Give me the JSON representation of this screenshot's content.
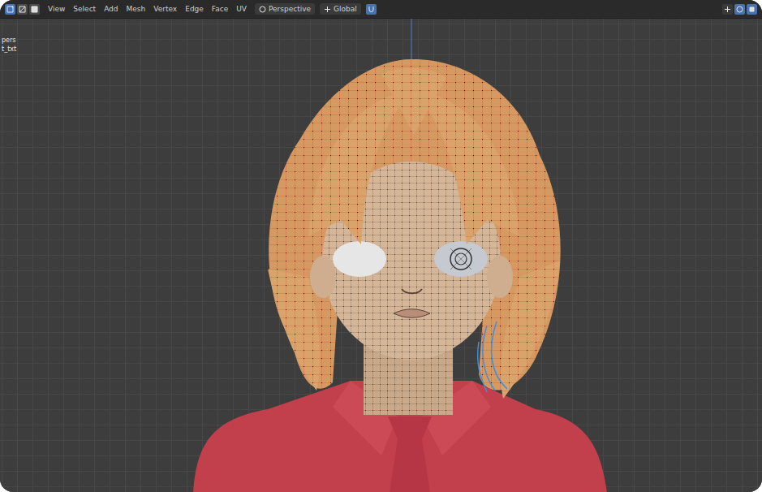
{
  "select_modes": [
    {
      "kind": "vertex",
      "selected": true
    },
    {
      "kind": "edge",
      "selected": false
    },
    {
      "kind": "face",
      "selected": false
    }
  ],
  "menus": [
    "View",
    "Select",
    "Add",
    "Mesh",
    "Vertex",
    "Edge",
    "Face",
    "UV"
  ],
  "pivot": "Perspective",
  "orientation": "Global",
  "snap": {
    "on": true
  },
  "right_tools": [
    {
      "kind": "gizmo",
      "on": false
    },
    {
      "kind": "overlay",
      "on": true
    },
    {
      "kind": "shading",
      "on": true
    }
  ],
  "overlay_lines": [
    "pers",
    "t_txt"
  ]
}
